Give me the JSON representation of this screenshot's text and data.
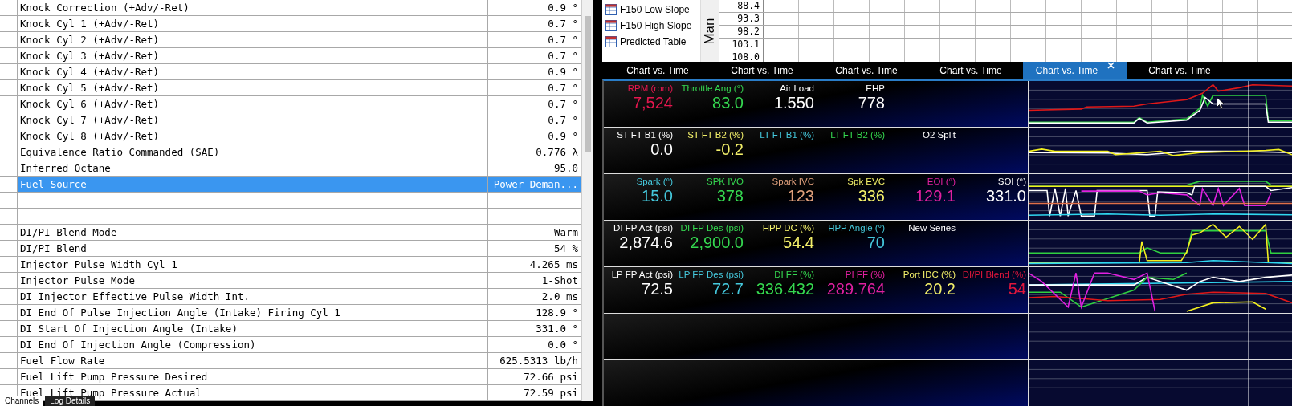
{
  "channel_table": {
    "rows": [
      {
        "kind": "data",
        "name": "Knock Correction (+Adv/-Ret)",
        "value": "0.9 °",
        "selected": false
      },
      {
        "kind": "data",
        "name": "Knock Cyl 1 (+Adv/-Ret)",
        "value": "0.7 °",
        "selected": false
      },
      {
        "kind": "data",
        "name": "Knock Cyl 2 (+Adv/-Ret)",
        "value": "0.7 °",
        "selected": false
      },
      {
        "kind": "data",
        "name": "Knock Cyl 3 (+Adv/-Ret)",
        "value": "0.7 °",
        "selected": false
      },
      {
        "kind": "data",
        "name": "Knock Cyl 4 (+Adv/-Ret)",
        "value": "0.9 °",
        "selected": false
      },
      {
        "kind": "data",
        "name": "Knock Cyl 5 (+Adv/-Ret)",
        "value": "0.7 °",
        "selected": false
      },
      {
        "kind": "data",
        "name": "Knock Cyl 6 (+Adv/-Ret)",
        "value": "0.7 °",
        "selected": false
      },
      {
        "kind": "data",
        "name": "Knock Cyl 7 (+Adv/-Ret)",
        "value": "0.7 °",
        "selected": false
      },
      {
        "kind": "data",
        "name": "Knock Cyl 8 (+Adv/-Ret)",
        "value": "0.9 °",
        "selected": false
      },
      {
        "kind": "data",
        "name": "Equivalence Ratio Commanded (SAE)",
        "value": "0.776 λ",
        "selected": false
      },
      {
        "kind": "data",
        "name": "Inferred Octane",
        "value": "95.0",
        "selected": false
      },
      {
        "kind": "data",
        "name": "Fuel Source",
        "value": "Power Deman...",
        "selected": true
      },
      {
        "kind": "blank"
      },
      {
        "kind": "blank"
      },
      {
        "kind": "data",
        "name": "DI/PI Blend Mode",
        "value": "Warm",
        "selected": false
      },
      {
        "kind": "data",
        "name": "DI/PI Blend",
        "value": "54 %",
        "selected": false
      },
      {
        "kind": "data",
        "name": "Injector Pulse Width Cyl 1",
        "value": "4.265 ms",
        "selected": false
      },
      {
        "kind": "data",
        "name": "Injector Pulse Mode",
        "value": "1-Shot",
        "selected": false
      },
      {
        "kind": "data",
        "name": "DI Injector Effective Pulse Width Int.",
        "value": "2.0 ms",
        "selected": false
      },
      {
        "kind": "data",
        "name": "DI End Of Pulse Injection Angle (Intake) Firing Cyl 1",
        "value": "128.9 °",
        "selected": false
      },
      {
        "kind": "data",
        "name": "DI Start Of Injection Angle (Intake)",
        "value": "331.0 °",
        "selected": false
      },
      {
        "kind": "data",
        "name": "DI End Of Injection Angle (Compression)",
        "value": "0.0 °",
        "selected": false
      },
      {
        "kind": "data",
        "name": "Fuel Flow Rate",
        "value": "625.5313 lb/h",
        "selected": false
      },
      {
        "kind": "data",
        "name": "Fuel Lift Pump Pressure Desired",
        "value": "72.66 psi",
        "selected": false
      },
      {
        "kind": "data",
        "name": "Fuel Lift Pump Pressure Actual",
        "value": "72.59 psi",
        "selected": false
      }
    ]
  },
  "bottom_tabs": [
    {
      "label": "Channels",
      "selected": true
    },
    {
      "label": "Log Details",
      "selected": false
    }
  ],
  "table_list": {
    "items": [
      {
        "label": "F150 Low Slope"
      },
      {
        "label": "F150 High Slope"
      },
      {
        "label": "Predicted Table"
      }
    ]
  },
  "table_grid": {
    "axis_label": "Man",
    "row_labels": [
      "88.4",
      "93.3",
      "98.2",
      "103.1",
      "108.0"
    ]
  },
  "chart_tabs": [
    {
      "label": "Chart vs. Time",
      "selected": false
    },
    {
      "label": "Chart vs. Time",
      "selected": false
    },
    {
      "label": "Chart vs. Time",
      "selected": false
    },
    {
      "label": "Chart vs. Time",
      "selected": false
    },
    {
      "label": "Chart vs. Time",
      "selected": true
    },
    {
      "label": "Chart vs. Time",
      "selected": false
    }
  ],
  "gauge_rows": [
    [
      {
        "label": "RPM (rpm)",
        "value": "7,524",
        "color": "#e5174f"
      },
      {
        "label": "Throttle Ang (°)",
        "value": "83.0",
        "color": "#35d850"
      },
      {
        "label": "Air Load",
        "value": "1.550",
        "color": "#ffffff"
      },
      {
        "label": "EHP",
        "value": "778",
        "color": "#ffffff"
      }
    ],
    [
      {
        "label": "ST FT B1 (%)",
        "value": "0.0",
        "color": "#ffffff"
      },
      {
        "label": "ST FT B2 (%)",
        "value": "-0.2",
        "color": "#f2ef6a"
      },
      {
        "label": "LT FT B1 (%)",
        "color": "#45c8dc"
      },
      {
        "label": "LT FT B2 (%)",
        "color": "#35d850"
      },
      {
        "label": "O2 Split",
        "color": "#ffffff"
      }
    ],
    [
      {
        "label": "Spark (°)",
        "value": "15.0",
        "color": "#45c8dc"
      },
      {
        "label": "SPK IVO",
        "value": "378",
        "color": "#35d850"
      },
      {
        "label": "Spark IVC",
        "value": "123",
        "color": "#e0a07c"
      },
      {
        "label": "Spk EVC",
        "value": "336",
        "color": "#f2ef6a"
      },
      {
        "label": "EOI (°)",
        "value": "129.1",
        "color": "#e020a0"
      },
      {
        "label": "SOI (°)",
        "value": "331.0",
        "color": "#ffffff"
      }
    ],
    [
      {
        "label": "DI FP Act (psi)",
        "value": "2,874.6",
        "color": "#ffffff"
      },
      {
        "label": "DI FP Des (psi)",
        "value": "2,900.0",
        "color": "#35d850"
      },
      {
        "label": "HPP DC (%)",
        "value": "54.4",
        "color": "#f2ef6a"
      },
      {
        "label": "HPP Angle (°)",
        "value": "70",
        "color": "#45c8dc"
      },
      {
        "label": "New Series",
        "color": "#ffffff"
      }
    ],
    [
      {
        "label": "LP FP Act (psi)",
        "value": "72.5",
        "color": "#ffffff"
      },
      {
        "label": "LP FP Des (psi)",
        "value": "72.7",
        "color": "#45c8dc"
      },
      {
        "label": "DI FF (%)",
        "value": "336.432",
        "color": "#35d850"
      },
      {
        "label": "PI FF (%)",
        "value": "289.764",
        "color": "#e020a0"
      },
      {
        "label": "Port IDC (%)",
        "value": "20.2",
        "color": "#f2ef6a"
      },
      {
        "label": "DI/PI Blend (%)",
        "value": "54",
        "color": "#e0163c"
      }
    ]
  ]
}
